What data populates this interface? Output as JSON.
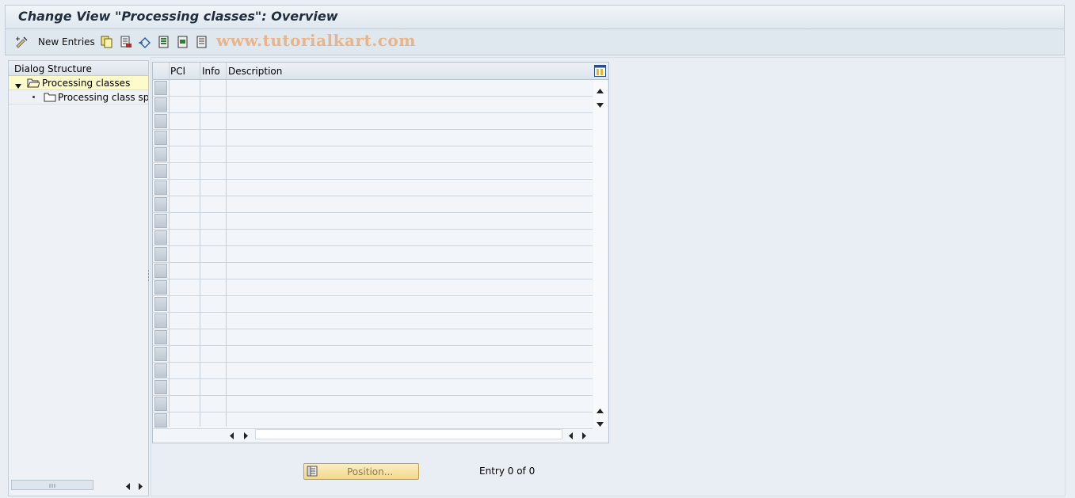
{
  "window": {
    "title": "Change View \"Processing classes\": Overview"
  },
  "toolbar": {
    "new_entries_label": "New Entries",
    "watermark": "www.tutorialkart.com"
  },
  "dialog_structure": {
    "header": "Dialog Structure",
    "items": [
      {
        "label": "Processing classes",
        "selected": true
      },
      {
        "label": "Processing class spec"
      }
    ]
  },
  "table": {
    "columns": [
      "PCl",
      "Info",
      "Description"
    ],
    "row_count": 21
  },
  "footer": {
    "position_button_label": "Position...",
    "entry_text": "Entry 0 of 0"
  },
  "colors": {
    "selected_tree_row": "#fdfbc9",
    "position_button": "#f2d98a",
    "watermark": "#e8b48a"
  }
}
